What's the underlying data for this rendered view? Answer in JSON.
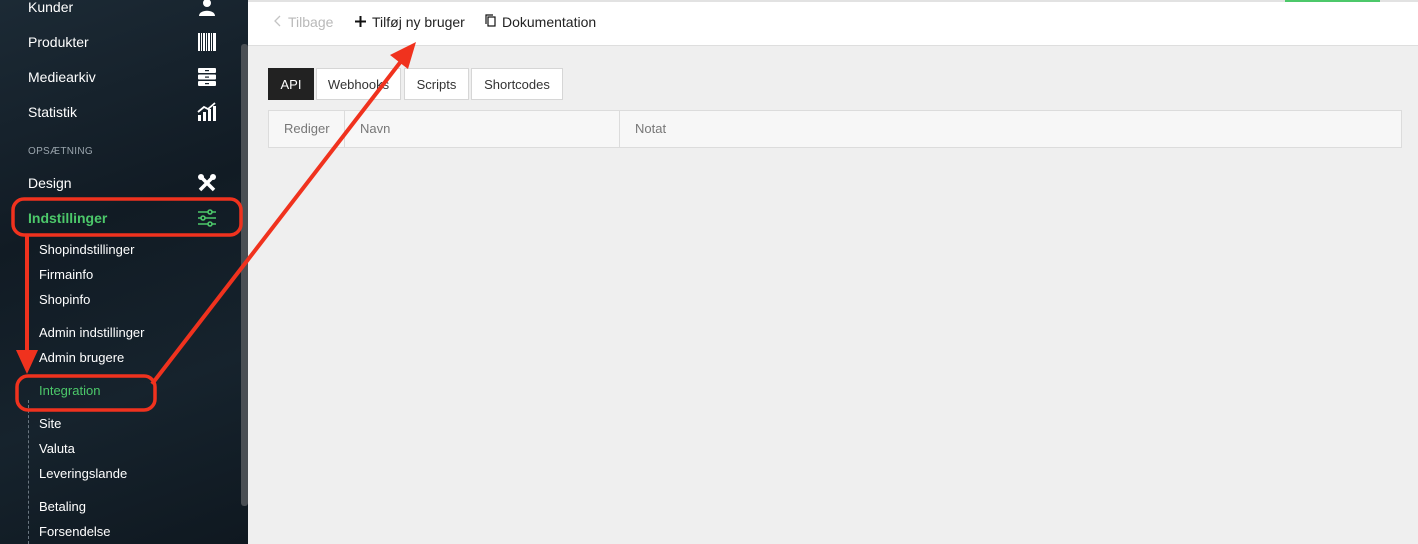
{
  "sidebar": {
    "items": [
      {
        "label": "Kunder",
        "icon": "user-icon"
      },
      {
        "label": "Produkter",
        "icon": "barcode-icon"
      },
      {
        "label": "Mediearkiv",
        "icon": "archive-icon"
      },
      {
        "label": "Statistik",
        "icon": "chart-icon"
      }
    ],
    "section_label": "OPSÆTNING",
    "design": {
      "label": "Design",
      "icon": "tools-icon"
    },
    "settings": {
      "label": "Indstillinger",
      "icon": "sliders-icon"
    },
    "sub_items": [
      "Shopindstillinger",
      "Firmainfo",
      "Shopinfo",
      "Admin indstillinger",
      "Admin brugere",
      "Integration",
      "Site",
      "Valuta",
      "Leveringslande",
      "Betaling",
      "Forsendelse"
    ],
    "active_sub": "Integration"
  },
  "toolbar": {
    "back_label": "Tilbage",
    "add_user_label": "Tilføj ny bruger",
    "docs_label": "Dokumentation"
  },
  "tabs": [
    {
      "label": "API",
      "active": true
    },
    {
      "label": "Webhooks",
      "active": false
    },
    {
      "label": "Scripts",
      "active": false
    },
    {
      "label": "Shortcodes",
      "active": false
    }
  ],
  "table": {
    "columns": [
      "Rediger",
      "Navn",
      "Notat"
    ]
  },
  "colors": {
    "accent_green": "#4cc86a",
    "annotation_red": "#f0321e",
    "sidebar_bg": "#14202a"
  }
}
